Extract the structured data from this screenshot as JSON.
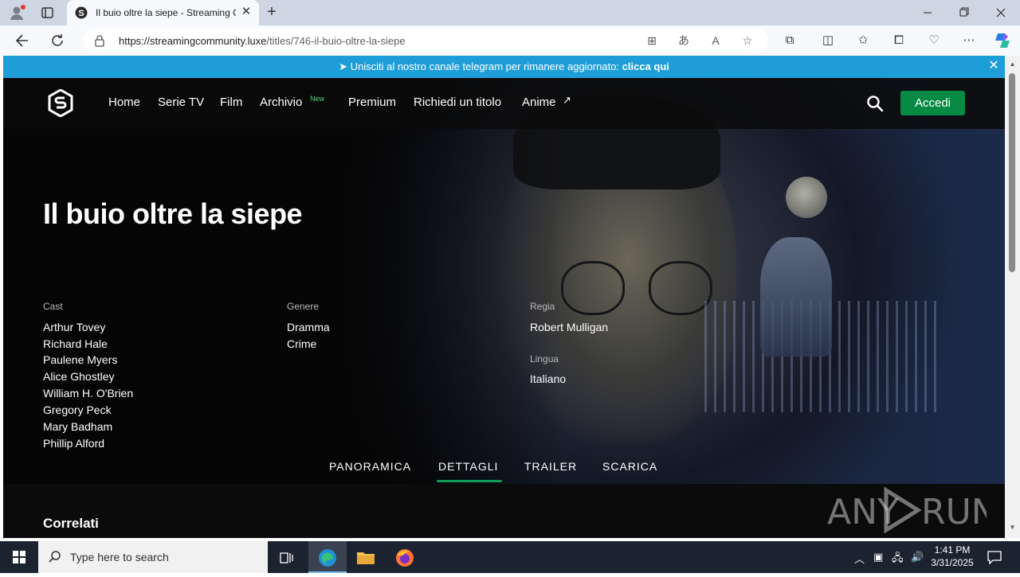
{
  "browser": {
    "tab_title": "Il buio oltre la siepe - Streaming Community",
    "url_host": "https://streamingcommunity.luxe",
    "url_path": "/titles/746-il-buio-oltre-la-siepe",
    "new_tab_symbol": "+",
    "tab_close_symbol": "✕"
  },
  "banner": {
    "text": "Unisciti al nostro canale telegram per rimanere aggiornato:",
    "link": "clicca qui",
    "close": "✕"
  },
  "site": {
    "nav": {
      "home": "Home",
      "serie_tv": "Serie TV",
      "film": "Film",
      "archivio": "Archivio",
      "archivio_badge": "New",
      "premium": "Premium",
      "richiedi": "Richiedi un titolo",
      "anime": "Anime",
      "anime_arrow": "↗"
    },
    "login": "Accedi"
  },
  "title": {
    "name": "Il buio oltre la siepe",
    "cast_label": "Cast",
    "cast": [
      "Arthur Tovey",
      "Richard Hale",
      "Paulene Myers",
      "Alice Ghostley",
      "William H. O'Brien",
      "Gregory Peck",
      "Mary Badham",
      "Phillip Alford"
    ],
    "genre_label": "Genere",
    "genres": [
      "Dramma",
      "Crime"
    ],
    "director_label": "Regia",
    "director": "Robert Mulligan",
    "language_label": "Lingua",
    "language": "Italiano"
  },
  "tabs": {
    "panoramica": "PANORAMICA",
    "dettagli": "DETTAGLI",
    "trailer": "TRAILER",
    "scarica": "SCARICA",
    "active": "DETTAGLI"
  },
  "related": "Correlati",
  "watermark": "ANY RUN",
  "taskbar": {
    "search_placeholder": "Type here to search",
    "time": "1:41 PM",
    "date": "3/31/2025"
  },
  "colors": {
    "banner": "#1e9ed9",
    "accent": "#078a43",
    "tab_underline": "#0e9b55",
    "new_badge": "#4fd17f"
  }
}
